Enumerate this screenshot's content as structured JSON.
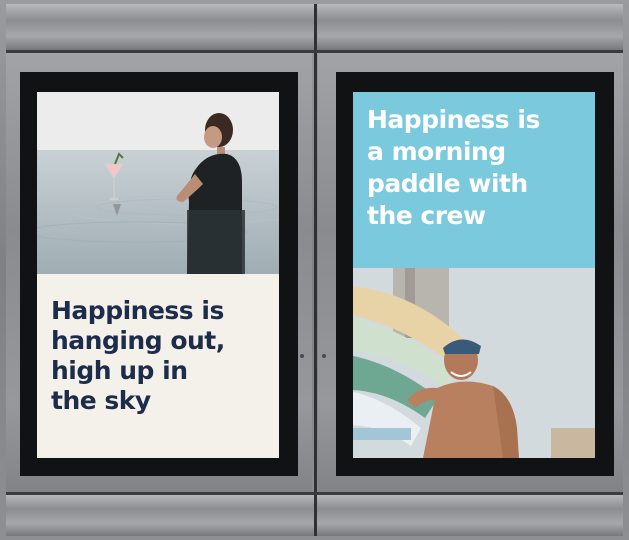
{
  "billboards": {
    "left": {
      "headline": "Happiness is\nhanging out,\nhigh up in\nthe sky",
      "photo": "woman standing in infinity pool with cocktail glass",
      "text_color": "#1d2c4a",
      "background_color": "#f4f1ea"
    },
    "right": {
      "headline": "Happiness is\na morning\npaddle with\nthe crew",
      "photo": "smiling man carrying surfboards on his shoulder",
      "text_color": "#ffffff",
      "background_color": "#7bc9dd"
    }
  },
  "colors": {
    "frame_metal": "#8a8b8e",
    "bezel": "#111214",
    "page_border": "#d9c9cc"
  }
}
